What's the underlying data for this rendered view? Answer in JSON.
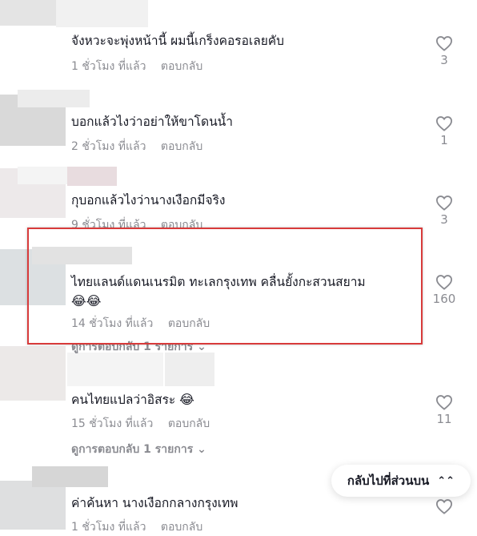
{
  "comments": [
    {
      "text": "จังหวะจะพุ่งหน้านี้ ผมนี้เกร็งคอรอเลยคับ",
      "time": "1 ชั่วโมง ที่แล้ว",
      "reply": "ตอบกลับ",
      "likes": "3"
    },
    {
      "text": "บอกแล้วไงว่าอย่าให้ขาโดนน้ำ",
      "time": "2 ชั่วโมง ที่แล้ว",
      "reply": "ตอบกลับ",
      "likes": "1"
    },
    {
      "text": "กุบอกแล้วไงว่านางเงือกมีจริง",
      "time": "9 ชั่วโมง ที่แล้ว",
      "reply": "ตอบกลับ",
      "likes": "3"
    },
    {
      "text": "ไทยแลนด์แดนเนรมิต ทะเลกรุงเทพ คลื่นยั้งกะสวนสยาม",
      "emoji": "😂😂",
      "time": "14 ชั่วโมง ที่แล้ว",
      "reply": "ตอบกลับ",
      "likes": "160",
      "view_replies": "ดูการตอบกลับ 1 รายการ"
    },
    {
      "text": "คนไทยแปลว่าอิสระ",
      "emoji": "😂",
      "time": "15 ชั่วโมง ที่แล้ว",
      "reply": "ตอบกลับ",
      "likes": "11",
      "view_replies": "ดูการตอบกลับ 1 รายการ"
    },
    {
      "text": "ค่าค้นหา นางเงือกกลางกรุงเทพ",
      "time": "1 ชั่วโมง ที่แล้ว",
      "reply": "ตอบกลับ",
      "likes": ""
    }
  ],
  "back_to_top": {
    "label": "กลับไปที่ส่วนบน",
    "icon": "double-chevron-up-icon"
  },
  "colors": {
    "highlight": "#d83b3b",
    "muted": "#8a8b91",
    "text": "#161823"
  }
}
